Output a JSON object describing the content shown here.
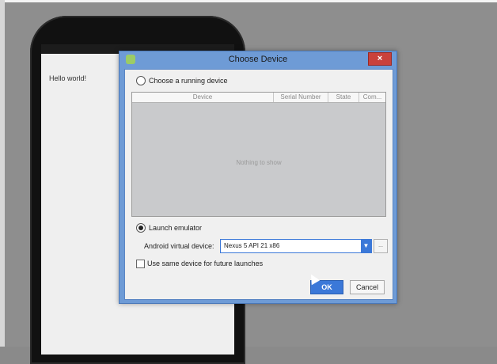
{
  "background": {
    "hello_text": "Hello world!"
  },
  "dialog": {
    "title": "Choose Device",
    "close_label": "×",
    "running_device": {
      "label": "Choose a running device",
      "columns": [
        "Device",
        "Serial Number",
        "State",
        "Com..."
      ],
      "empty_message": "Nothing to show"
    },
    "launch_emulator": {
      "label": "Launch emulator",
      "avd_label": "Android virtual device:",
      "avd_value": "Nexus 5 API 21 x86",
      "more_label": "..."
    },
    "same_device_label": "Use same device for future launches",
    "ok_label": "OK",
    "cancel_label": "Cancel"
  },
  "colors": {
    "dialog_frame": "#6e9bd6",
    "accent": "#3b78d8",
    "close": "#c9413b"
  },
  "icons": {
    "app_icon": "android-icon",
    "combo_arrow": "chevron-down-icon"
  }
}
